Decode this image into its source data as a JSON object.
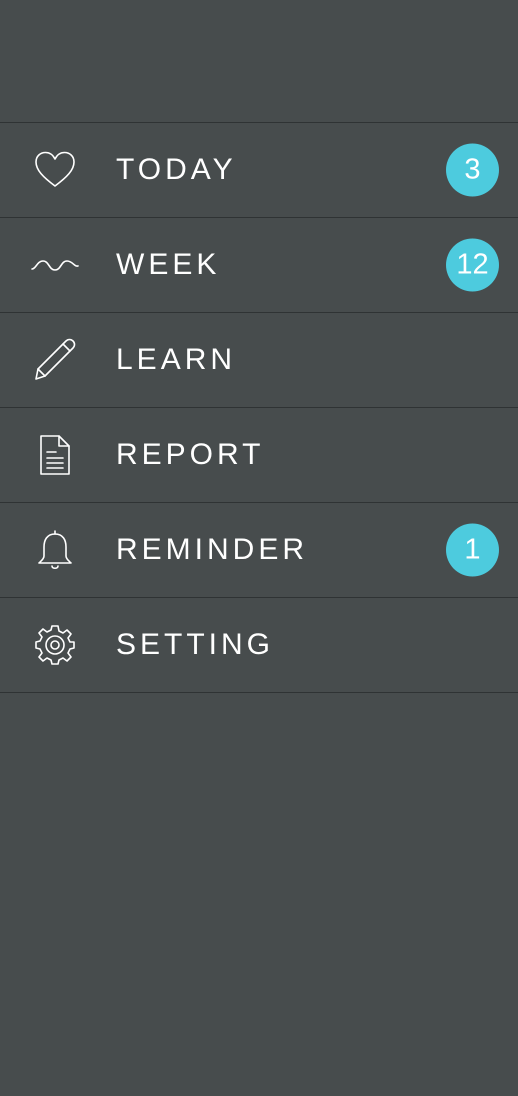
{
  "colors": {
    "background": "#474c4d",
    "divider": "#2f3334",
    "text": "#ffffff",
    "badge": "#4dcbde"
  },
  "menu": {
    "items": [
      {
        "label": "TODAY",
        "icon": "heart-icon",
        "badge": "3"
      },
      {
        "label": "WEEK",
        "icon": "wave-icon",
        "badge": "12"
      },
      {
        "label": "LEARN",
        "icon": "pencil-icon"
      },
      {
        "label": "REPORT",
        "icon": "document-icon"
      },
      {
        "label": "REMINDER",
        "icon": "bell-icon",
        "badge": "1"
      },
      {
        "label": "SETTING",
        "icon": "gear-icon"
      }
    ]
  }
}
